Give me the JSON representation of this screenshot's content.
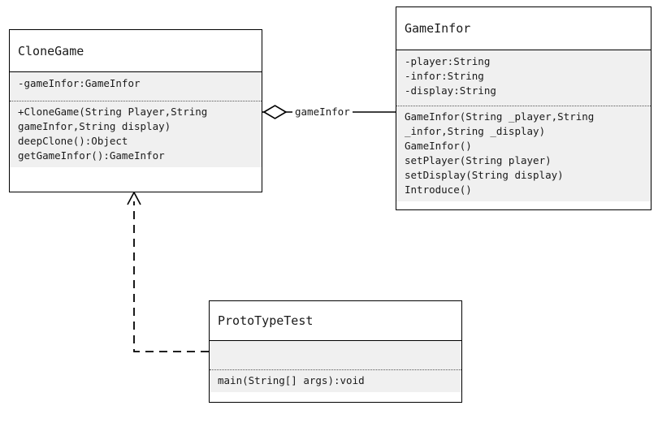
{
  "diagram": {
    "type": "uml-class-diagram",
    "background_color": "#ffffff",
    "line_color": "#000000",
    "section_fill_color": "#f0f0f0",
    "header_fill_color": "#ffffff"
  },
  "classes": [
    {
      "id": "CloneGame",
      "name": "CloneGame",
      "attributes": [
        "-gameInfor:GameInfor"
      ],
      "operations": [
        "+CloneGame(String Player,String gameInfor,String display)",
        "deepClone():Object",
        "getGameInfor():GameInfor"
      ]
    },
    {
      "id": "GameInfor",
      "name": "GameInfor",
      "attributes": [
        "-player:String",
        "-infor:String",
        "-display:String"
      ],
      "operations": [
        "GameInfor(String _player,String _infor,String _display)",
        "GameInfor()",
        "setPlayer(String player)",
        "setDisplay(String display)",
        "Introduce()"
      ]
    },
    {
      "id": "ProtoTypeTest",
      "name": "ProtoTypeTest",
      "attributes": [],
      "operations": [
        "main(String[] args):void"
      ]
    }
  ],
  "relations": [
    {
      "id": "aggregation-clonegame-gameinfor",
      "kind": "aggregation",
      "from": "CloneGame",
      "to": "GameInfor",
      "label": "gameInfor",
      "marker": "hollow-diamond",
      "line_style": "solid"
    },
    {
      "id": "realization-prototypetest-clonegame",
      "kind": "realization",
      "from": "ProtoTypeTest",
      "to": "CloneGame",
      "label": "",
      "marker": "hollow-arrowhead",
      "line_style": "dashed"
    }
  ]
}
